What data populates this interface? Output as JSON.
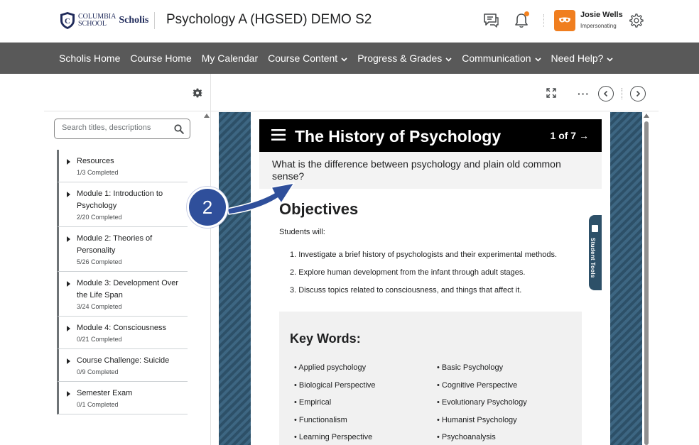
{
  "header": {
    "logo_line1": "COLUMBIA",
    "logo_line2": "SCHOOL",
    "logo_brand": "Scholis",
    "course_title": "Psychology A (HGSED) DEMO S2",
    "user_name": "Josie Wells",
    "user_status": "Impersonating"
  },
  "nav": {
    "items": [
      {
        "label": "Scholis Home",
        "dropdown": false
      },
      {
        "label": "Course Home",
        "dropdown": false
      },
      {
        "label": "My Calendar",
        "dropdown": false
      },
      {
        "label": "Course Content",
        "dropdown": true
      },
      {
        "label": "Progress & Grades",
        "dropdown": true
      },
      {
        "label": "Communication",
        "dropdown": true
      },
      {
        "label": "Need Help?",
        "dropdown": true
      }
    ]
  },
  "sidebar": {
    "search_placeholder": "Search titles, descriptions",
    "modules": [
      {
        "title": "Resources",
        "progress": "1/3 Completed"
      },
      {
        "title": "Module 1: Introduction to Psychology",
        "progress": "2/20 Completed"
      },
      {
        "title": "Module 2: Theories of Personality",
        "progress": "5/26 Completed"
      },
      {
        "title": "Module 3: Development Over the Life Span",
        "progress": "3/24 Completed"
      },
      {
        "title": "Module 4: Consciousness",
        "progress": "0/21 Completed"
      },
      {
        "title": "Course Challenge: Suicide",
        "progress": "0/9 Completed"
      },
      {
        "title": "Semester Exam",
        "progress": "0/1 Completed"
      }
    ]
  },
  "content": {
    "banner_title": "The History of Psychology",
    "page_indicator": "1 of 7",
    "question": "What is the difference between psychology and plain old common sense?",
    "objectives_title": "Objectives",
    "objectives_lead": "Students will:",
    "objectives": [
      "1. Investigate a brief history of psychologists and their experimental methods.",
      "2. Explore human development from the infant through adult stages.",
      "3. Discuss topics related to consciousness, and things that affect it."
    ],
    "keywords_title": "Key Words:",
    "keywords_left": [
      "• Applied psychology",
      "• Biological Perspective",
      "• Empirical",
      "• Functionalism",
      "• Learning Perspective"
    ],
    "keywords_right": [
      "• Basic Psychology",
      "• Cognitive Perspective",
      "• Evolutionary Psychology",
      "• Humanist Psychology",
      "• Psychoanalysis"
    ],
    "student_tools_label": "Student Tools"
  },
  "callout": {
    "number": "2"
  },
  "colors": {
    "navbar": "#595959",
    "accent_orange": "#f07e1f",
    "callout_blue": "#2f4f9b",
    "frame_teal": "#2d5068"
  }
}
